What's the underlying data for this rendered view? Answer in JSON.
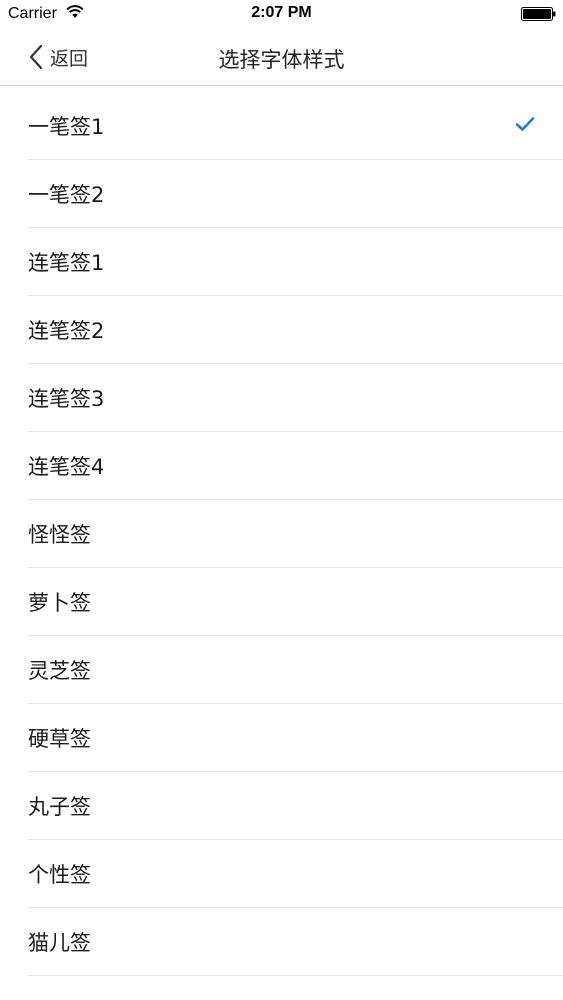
{
  "status_bar": {
    "carrier": "Carrier",
    "time": "2:07 PM",
    "wifi_icon": "wifi-icon",
    "battery_icon": "battery-icon"
  },
  "nav": {
    "back_label": "返回",
    "back_icon": "chevron-left-icon",
    "title": "选择字体样式"
  },
  "colors": {
    "accent": "#1a7ee0",
    "separator": "#e6e6e6"
  },
  "font_styles": [
    {
      "label": "一笔签1",
      "selected": true
    },
    {
      "label": "一笔签2",
      "selected": false
    },
    {
      "label": "连笔签1",
      "selected": false
    },
    {
      "label": "连笔签2",
      "selected": false
    },
    {
      "label": "连笔签3",
      "selected": false
    },
    {
      "label": "连笔签4",
      "selected": false
    },
    {
      "label": "怪怪签",
      "selected": false
    },
    {
      "label": "萝卜签",
      "selected": false
    },
    {
      "label": "灵芝签",
      "selected": false
    },
    {
      "label": "硬草签",
      "selected": false
    },
    {
      "label": "丸子签",
      "selected": false
    },
    {
      "label": "个性签",
      "selected": false
    },
    {
      "label": "猫儿签",
      "selected": false
    }
  ]
}
